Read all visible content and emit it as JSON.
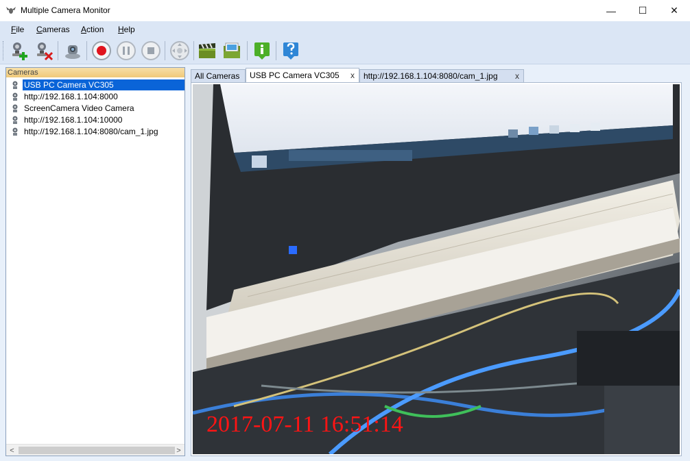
{
  "window": {
    "title": "Multiple Camera Monitor",
    "minimize_glyph": "—",
    "maximize_glyph": "☐",
    "close_glyph": "✕"
  },
  "menu": {
    "items": [
      {
        "label": "File",
        "accel": "F",
        "rest": "ile"
      },
      {
        "label": "Cameras",
        "accel": "C",
        "rest": "ameras"
      },
      {
        "label": "Action",
        "accel": "A",
        "rest": "ction"
      },
      {
        "label": "Help",
        "accel": "H",
        "rest": "elp"
      }
    ]
  },
  "toolbar": {
    "buttons": [
      {
        "icon": "add-camera-icon"
      },
      {
        "icon": "remove-camera-icon"
      },
      {
        "icon": "webcam-icon"
      },
      {
        "icon": "record-icon"
      },
      {
        "icon": "pause-icon"
      },
      {
        "icon": "stop-icon"
      },
      {
        "icon": "ptz-control-icon"
      },
      {
        "icon": "video-clip-icon"
      },
      {
        "icon": "photo-folder-icon"
      },
      {
        "icon": "info-icon"
      },
      {
        "icon": "help-icon"
      }
    ]
  },
  "cameras_panel": {
    "header": "Cameras",
    "items": [
      {
        "label": "USB PC Camera VC305",
        "selected": true
      },
      {
        "label": "http://192.168.1.104:8000",
        "selected": false
      },
      {
        "label": "ScreenCamera Video Camera",
        "selected": false
      },
      {
        "label": "http://192.168.1.104:10000",
        "selected": false
      },
      {
        "label": "http://192.168.1.104:8080/cam_1.jpg",
        "selected": false
      }
    ],
    "scroll_left": "<",
    "scroll_right": ">"
  },
  "tabs": [
    {
      "label": "All Cameras",
      "closable": false,
      "active": false
    },
    {
      "label": "USB PC Camera VC305",
      "closable": true,
      "active": true
    },
    {
      "label": "http://192.168.1.104:8080/cam_1.jpg",
      "closable": true,
      "active": false
    }
  ],
  "tab_close_glyph": "x",
  "viewer": {
    "timestamp": "2017-07-11 16:51:14"
  },
  "colors": {
    "selection": "#0a64d8",
    "timestamp": "#ff1414",
    "record": "#e0141e",
    "toolbar_bg": "#dbe6f5"
  }
}
